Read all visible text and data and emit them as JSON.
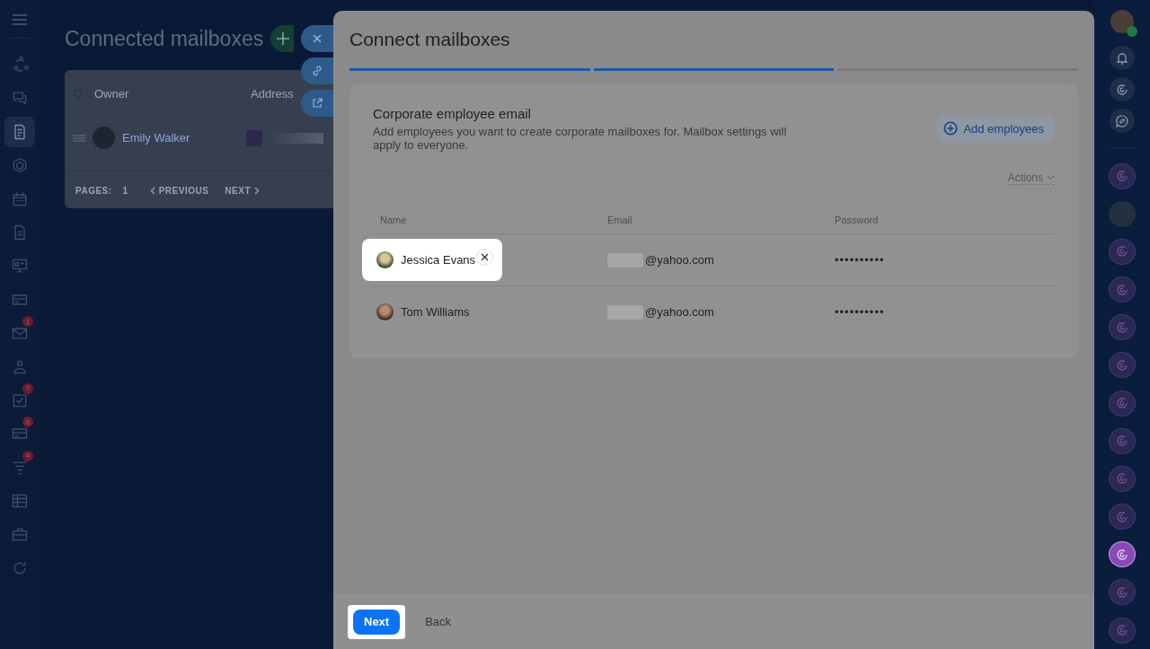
{
  "left_sidebar": {
    "items": [
      {
        "kind": "circles",
        "selected": false
      },
      {
        "kind": "chat",
        "selected": false
      },
      {
        "kind": "document",
        "selected": true
      },
      {
        "kind": "hexagon",
        "selected": false
      },
      {
        "kind": "calendar",
        "selected": false
      },
      {
        "kind": "file",
        "selected": false
      },
      {
        "kind": "board",
        "selected": false
      },
      {
        "kind": "card",
        "selected": false
      },
      {
        "kind": "mail",
        "selected": false,
        "badge": "1"
      },
      {
        "kind": "people",
        "selected": false
      },
      {
        "kind": "task",
        "selected": false,
        "badge": "7"
      },
      {
        "kind": "card",
        "selected": false,
        "badge": "6"
      },
      {
        "kind": "filter",
        "selected": false,
        "badge": "4"
      },
      {
        "kind": "table",
        "selected": false
      },
      {
        "kind": "briefcase",
        "selected": false
      },
      {
        "kind": "refresh",
        "selected": false
      }
    ]
  },
  "background_page": {
    "title": "Connected mailboxes",
    "columns": [
      "Owner",
      "Address"
    ],
    "rows": [
      {
        "owner": "Emily Walker"
      }
    ],
    "pager": {
      "label": "PAGES:",
      "page": "1",
      "previous": "PREVIOUS",
      "next": "NEXT"
    }
  },
  "panel": {
    "title": "Connect mailboxes",
    "steps": [
      {
        "done": true
      },
      {
        "done": true
      },
      {
        "done": false
      }
    ],
    "section": {
      "title": "Corporate employee email",
      "description": "Add employees you want to create corporate mailboxes for. Mailbox settings will apply to everyone.",
      "add_button": "Add employees",
      "actions": "Actions",
      "columns": [
        "Name",
        "Email",
        "Password"
      ],
      "rows": [
        {
          "name": "Jessica Evans",
          "email": "@yahoo.com",
          "password": "••••••••••",
          "highlighted": true
        },
        {
          "name": "Tom Williams",
          "email": "@yahoo.com",
          "password": "••••••••••",
          "highlighted": false
        }
      ]
    },
    "footer": {
      "next": "Next",
      "next_highlighted": true,
      "back": "Back"
    }
  },
  "right_bar": {
    "items": [
      {
        "kind": "app",
        "selected": false
      },
      {
        "kind": "avatar",
        "selected": false
      },
      {
        "kind": "app",
        "selected": false
      },
      {
        "kind": "app",
        "selected": false
      },
      {
        "kind": "app",
        "selected": false
      },
      {
        "kind": "app",
        "selected": false
      },
      {
        "kind": "app",
        "selected": false
      },
      {
        "kind": "app",
        "selected": false
      },
      {
        "kind": "app",
        "selected": false
      },
      {
        "kind": "app",
        "selected": false
      },
      {
        "kind": "app",
        "selected": true
      },
      {
        "kind": "app",
        "selected": false
      },
      {
        "kind": "app",
        "selected": false
      }
    ]
  }
}
